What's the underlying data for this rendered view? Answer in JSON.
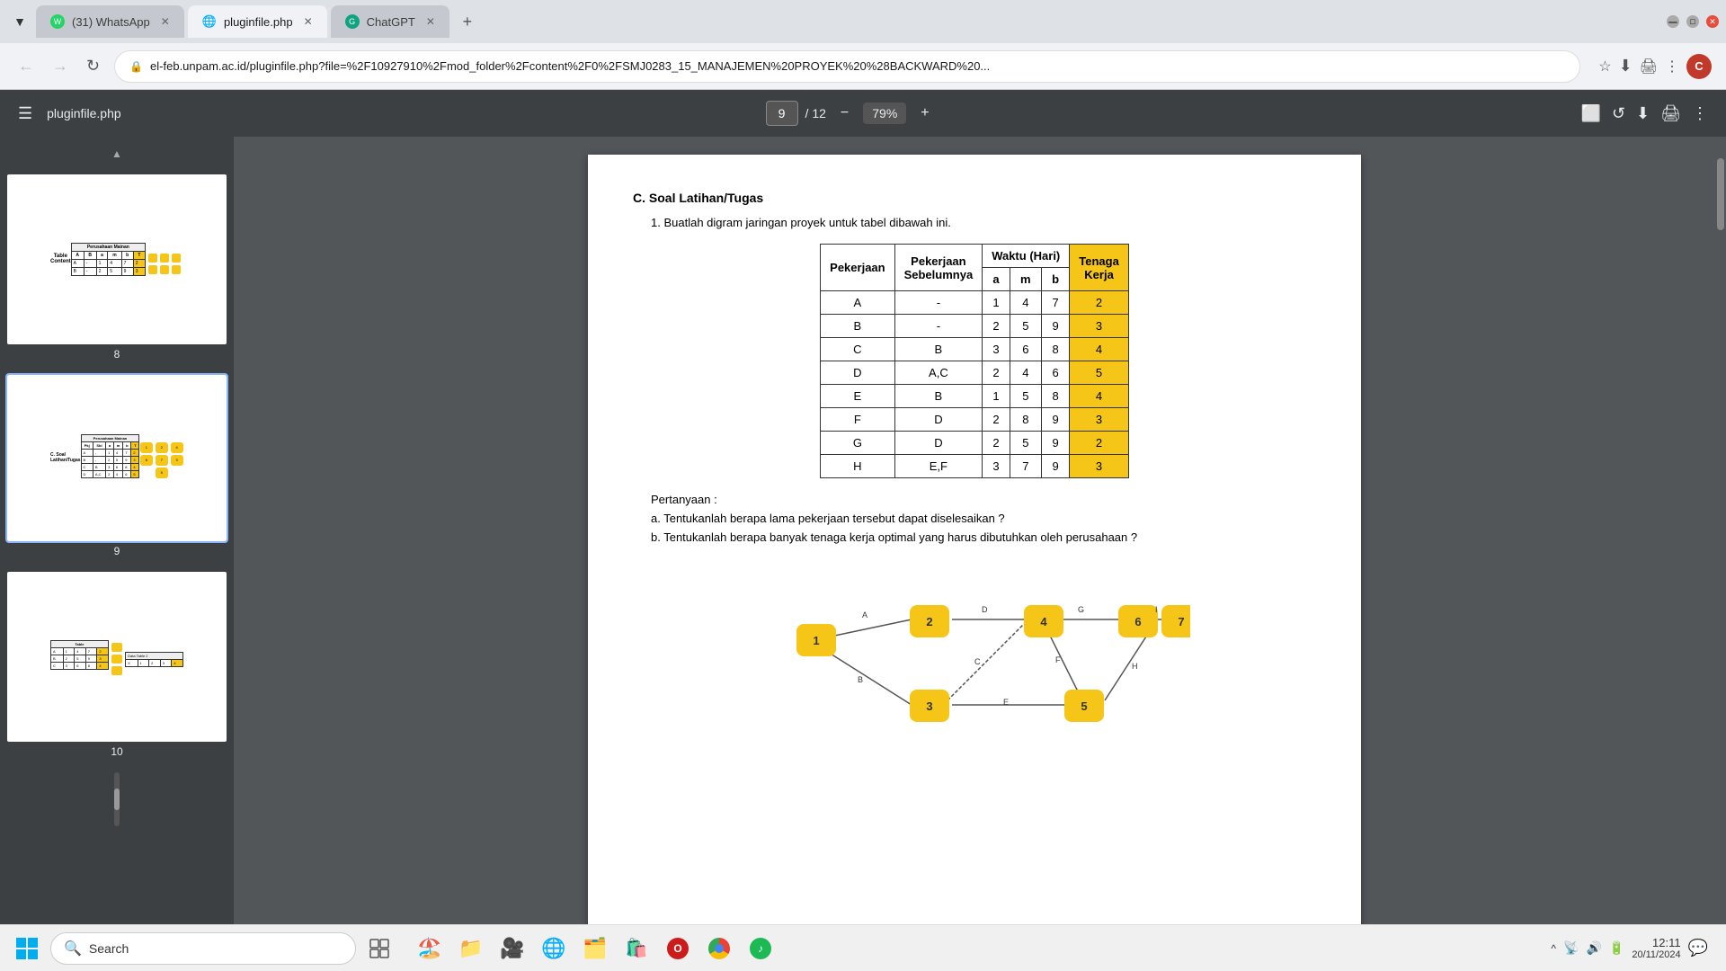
{
  "browser": {
    "tabs": [
      {
        "id": "whatsapp",
        "label": "(31) WhatsApp",
        "icon": "WA",
        "icon_color": "#25d366",
        "active": false
      },
      {
        "id": "pluginfile",
        "label": "pluginfile.php",
        "icon": "🌐",
        "active": true
      },
      {
        "id": "chatgpt",
        "label": "ChatGPT",
        "icon": "GP",
        "icon_color": "#10a37f",
        "active": false
      }
    ],
    "url": "el-feb.unpam.ac.id/pluginfile.php?file=%2F10927910%2Fmod_folder%2Fcontent%2F0%2FSMJ0283_15_MANAJEMEN%20PROYEK%20%28BACKWARD%20...",
    "profile_initial": "C"
  },
  "pdf_viewer": {
    "title": "pluginfile.php",
    "current_page": "9",
    "total_pages": "12",
    "zoom": "79%"
  },
  "document": {
    "section_c": "C. Soal Latihan/Tugas",
    "question_1": "1.  Buatlah digram jaringan proyek untuk tabel dibawah ini.",
    "table_title": "Perusahaan Mainan",
    "table_headers": [
      "Pekerjaan",
      "Pekerjaan Sebelumnya",
      "a",
      "m",
      "b",
      "Tenaga Kerja"
    ],
    "waktu_hari": "Waktu (Hari)",
    "table_rows": [
      {
        "pekerjaan": "A",
        "sebelumnya": "-",
        "a": "1",
        "m": "4",
        "b": "7",
        "tenaga": "2"
      },
      {
        "pekerjaan": "B",
        "sebelumnya": "-",
        "a": "2",
        "m": "5",
        "b": "9",
        "tenaga": "3"
      },
      {
        "pekerjaan": "C",
        "sebelumnya": "B",
        "a": "3",
        "m": "6",
        "b": "8",
        "tenaga": "4"
      },
      {
        "pekerjaan": "D",
        "sebelumnya": "A,C",
        "a": "2",
        "m": "4",
        "b": "6",
        "tenaga": "5"
      },
      {
        "pekerjaan": "E",
        "sebelumnya": "B",
        "a": "1",
        "m": "5",
        "b": "8",
        "tenaga": "4"
      },
      {
        "pekerjaan": "F",
        "sebelumnya": "D",
        "a": "2",
        "m": "8",
        "b": "9",
        "tenaga": "3"
      },
      {
        "pekerjaan": "G",
        "sebelumnya": "D",
        "a": "2",
        "m": "5",
        "b": "9",
        "tenaga": "2"
      },
      {
        "pekerjaan": "H",
        "sebelumnya": "E,F",
        "a": "3",
        "m": "7",
        "b": "9",
        "tenaga": "3"
      }
    ],
    "pertanyaan_label": "Pertanyaan :",
    "question_a": "a.  Tentukanlah berapa lama pekerjaan tersebut dapat diselesaikan ?",
    "question_b": "b.  Tentukanlah berapa banyak tenaga kerja optimal yang harus dibutuhkan oleh perusahaan ?"
  },
  "sidebar": {
    "page8_num": "8",
    "page9_num": "9"
  },
  "taskbar": {
    "search_placeholder": "Search",
    "clock_time": "12:11",
    "clock_date": "20/11/2024"
  },
  "colors": {
    "yellow": "#f5c518",
    "node_color": "#f5c518",
    "browser_tab_bg": "#dee1e6",
    "pdf_toolbar_bg": "#3c4043"
  }
}
